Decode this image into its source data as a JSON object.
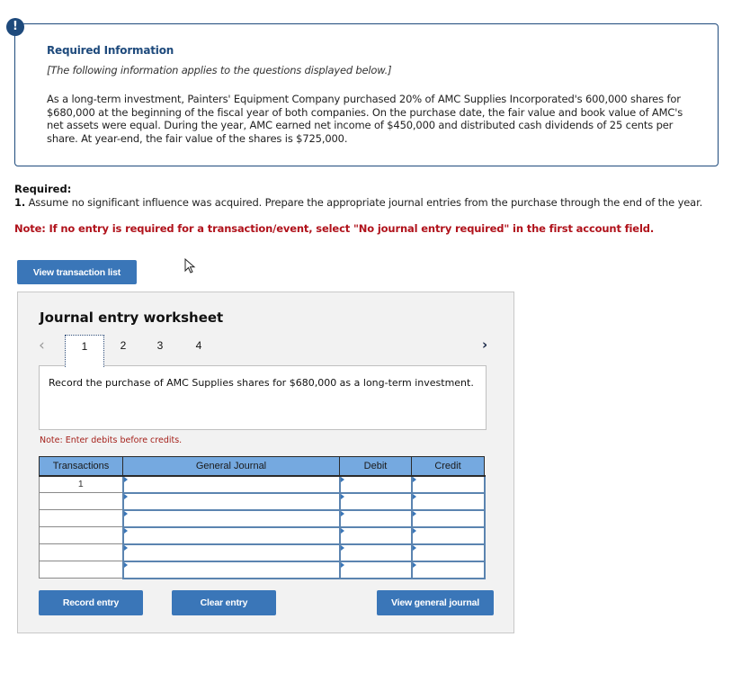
{
  "info": {
    "badge": "!",
    "title": "Required Information",
    "subtitle": "[The following information applies to the questions displayed below.]",
    "body": "As a long-term investment, Painters' Equipment Company purchased 20% of AMC Supplies Incorporated's 600,000 shares for $680,000 at the beginning of the fiscal year of both companies. On the purchase date, the fair value and book value of AMC's net assets were equal. During the year, AMC earned net income of $450,000 and distributed cash dividends of 25 cents per share. At year-end, the fair value of the shares is $725,000."
  },
  "required": {
    "heading": "Required:",
    "item_number": "1.",
    "item_text": " Assume no significant influence was acquired. Prepare the appropriate journal entries from the purchase through the end of the year.",
    "note": "Note: If no entry is required for a transaction/event, select \"No journal entry required\" in the first account field."
  },
  "buttons": {
    "view_transaction_list": "View transaction list",
    "record_entry": "Record entry",
    "clear_entry": "Clear entry",
    "view_general_journal": "View general journal"
  },
  "worksheet": {
    "title": "Journal entry worksheet",
    "prev_icon": "‹",
    "next_icon": "›",
    "pages": [
      "1",
      "2",
      "3",
      "4"
    ],
    "active_page": "1",
    "description": "Record the purchase of AMC Supplies shares for $680,000 as a long-term investment.",
    "note": "Note: Enter debits before credits.",
    "table": {
      "headers": [
        "Transactions",
        "General Journal",
        "Debit",
        "Credit"
      ],
      "rows": [
        {
          "transaction": "1",
          "account": "",
          "debit": "",
          "credit": ""
        },
        {
          "transaction": "",
          "account": "",
          "debit": "",
          "credit": ""
        },
        {
          "transaction": "",
          "account": "",
          "debit": "",
          "credit": ""
        },
        {
          "transaction": "",
          "account": "",
          "debit": "",
          "credit": ""
        },
        {
          "transaction": "",
          "account": "",
          "debit": "",
          "credit": ""
        },
        {
          "transaction": "",
          "account": "",
          "debit": "",
          "credit": ""
        }
      ]
    }
  },
  "colors": {
    "info_border": "#1e4a7c",
    "note_red": "#b0121b",
    "button_blue": "#3a76b8",
    "table_header": "#75a9e0"
  }
}
